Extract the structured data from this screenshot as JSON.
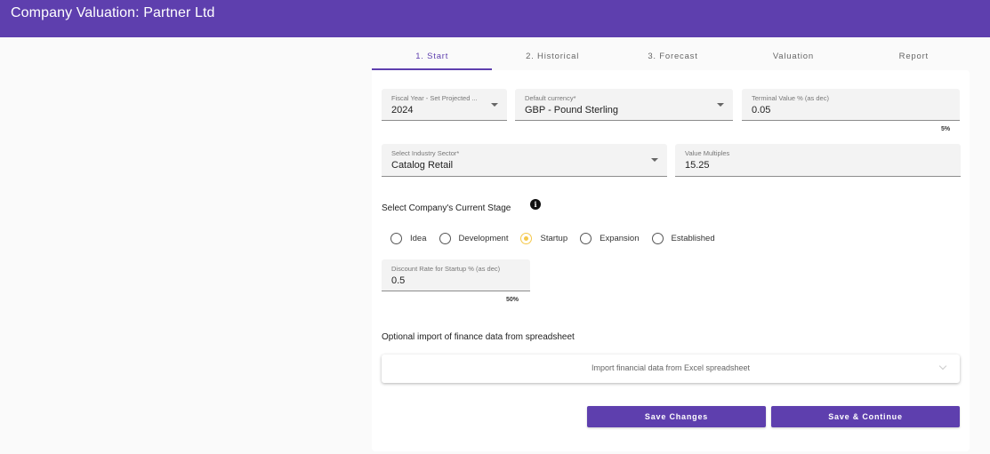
{
  "header": {
    "title": "Company Valuation: Partner Ltd"
  },
  "tabs": [
    {
      "label": "1. Start",
      "active": true
    },
    {
      "label": "2. Historical",
      "active": false
    },
    {
      "label": "3. Forecast",
      "active": false
    },
    {
      "label": "Valuation",
      "active": false
    },
    {
      "label": "Report",
      "active": false
    }
  ],
  "form": {
    "fiscal_year": {
      "label": "Fiscal Year - Set Projected ...",
      "value": "2024"
    },
    "currency": {
      "label": "Default currency*",
      "value": "GBP - Pound Sterling"
    },
    "terminal_value": {
      "label": "Terminal Value % (as dec)",
      "value": "0.05",
      "hint": "5%"
    },
    "industry": {
      "label": "Select Industry Sector*",
      "value": "Catalog Retail"
    },
    "value_multiples": {
      "label": "Value Multiples",
      "value": "15.25"
    },
    "stage": {
      "label": "Select Company's Current Stage",
      "info_icon": "info-icon",
      "options": [
        {
          "label": "Idea",
          "checked": false
        },
        {
          "label": "Development",
          "checked": false
        },
        {
          "label": "Startup",
          "checked": true
        },
        {
          "label": "Expansion",
          "checked": false
        },
        {
          "label": "Established",
          "checked": false
        }
      ],
      "checked_color": "#f5c84a"
    },
    "discount_rate": {
      "label": "Discount Rate for Startup % (as dec)",
      "value": "0.5",
      "hint": "50%"
    },
    "import": {
      "section_label": "Optional import of finance data from spreadsheet",
      "panel_label": "Import financial data from Excel spreadsheet"
    }
  },
  "actions": {
    "save": "Save Changes",
    "save_continue": "Save & Continue"
  },
  "colors": {
    "primary": "#5e3fae",
    "accent": "#f5c84a"
  }
}
